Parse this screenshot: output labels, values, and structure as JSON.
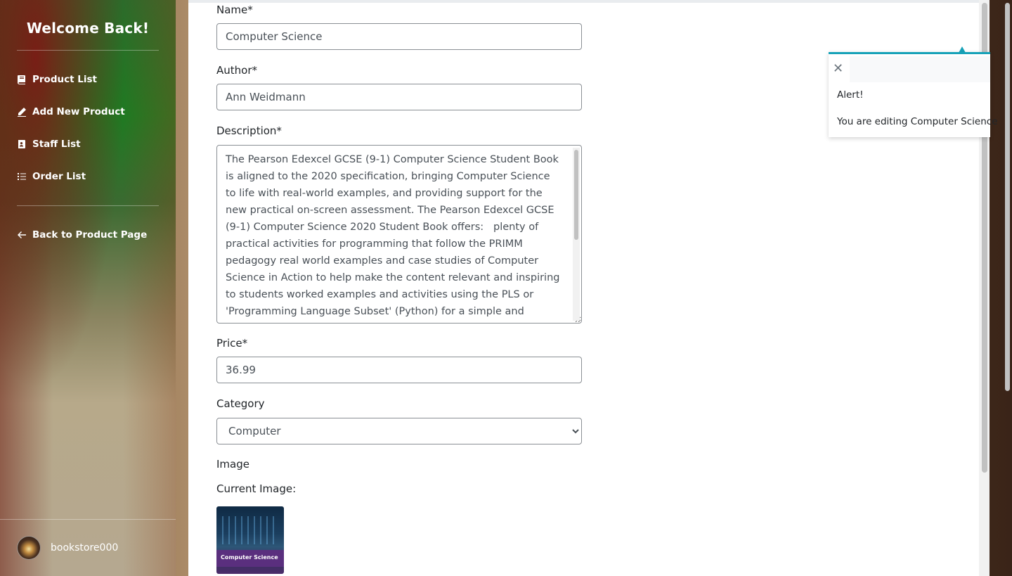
{
  "sidebar": {
    "title": "Welcome Back!",
    "items": [
      {
        "label": "Product List",
        "icon": "book-icon"
      },
      {
        "label": "Add New Product",
        "icon": "pencil-icon"
      },
      {
        "label": "Staff List",
        "icon": "address-book-icon"
      },
      {
        "label": "Order List",
        "icon": "list-icon"
      }
    ],
    "back_label": "Back to Product Page",
    "username": "bookstore000"
  },
  "form": {
    "name_label": "Name*",
    "name_value": "Computer Science",
    "author_label": "Author*",
    "author_value": "Ann Weidmann",
    "description_label": "Description*",
    "description_value": "The Pearson Edexcel GCSE (9-1) Computer Science Student Book is aligned to the 2020 specification, bringing Computer Science to life with real-world examples, and providing support for the new practical on-screen assessment. The Pearson Edexcel GCSE (9-1) Computer Science 2020 Student Book offers:   plenty of practical activities for programming that follow the PRIMM pedagogy real world examples and case studies of Computer Science in Action to help make the content relevant and inspiring to students worked examples and activities using the PLS or 'Programming Language Subset' (Python) for a simple and comprehensive approach to",
    "price_label": "Price*",
    "price_value": "36.99",
    "category_label": "Category",
    "category_selected": "Computer",
    "image_label": "Image",
    "current_image_label": "Current Image:",
    "thumbnail_text": "Computer Science"
  },
  "toast": {
    "title": "Alert!",
    "message": "You are editing Computer Science",
    "close_symbol": "✕",
    "accent_color": "#17a2b8"
  }
}
